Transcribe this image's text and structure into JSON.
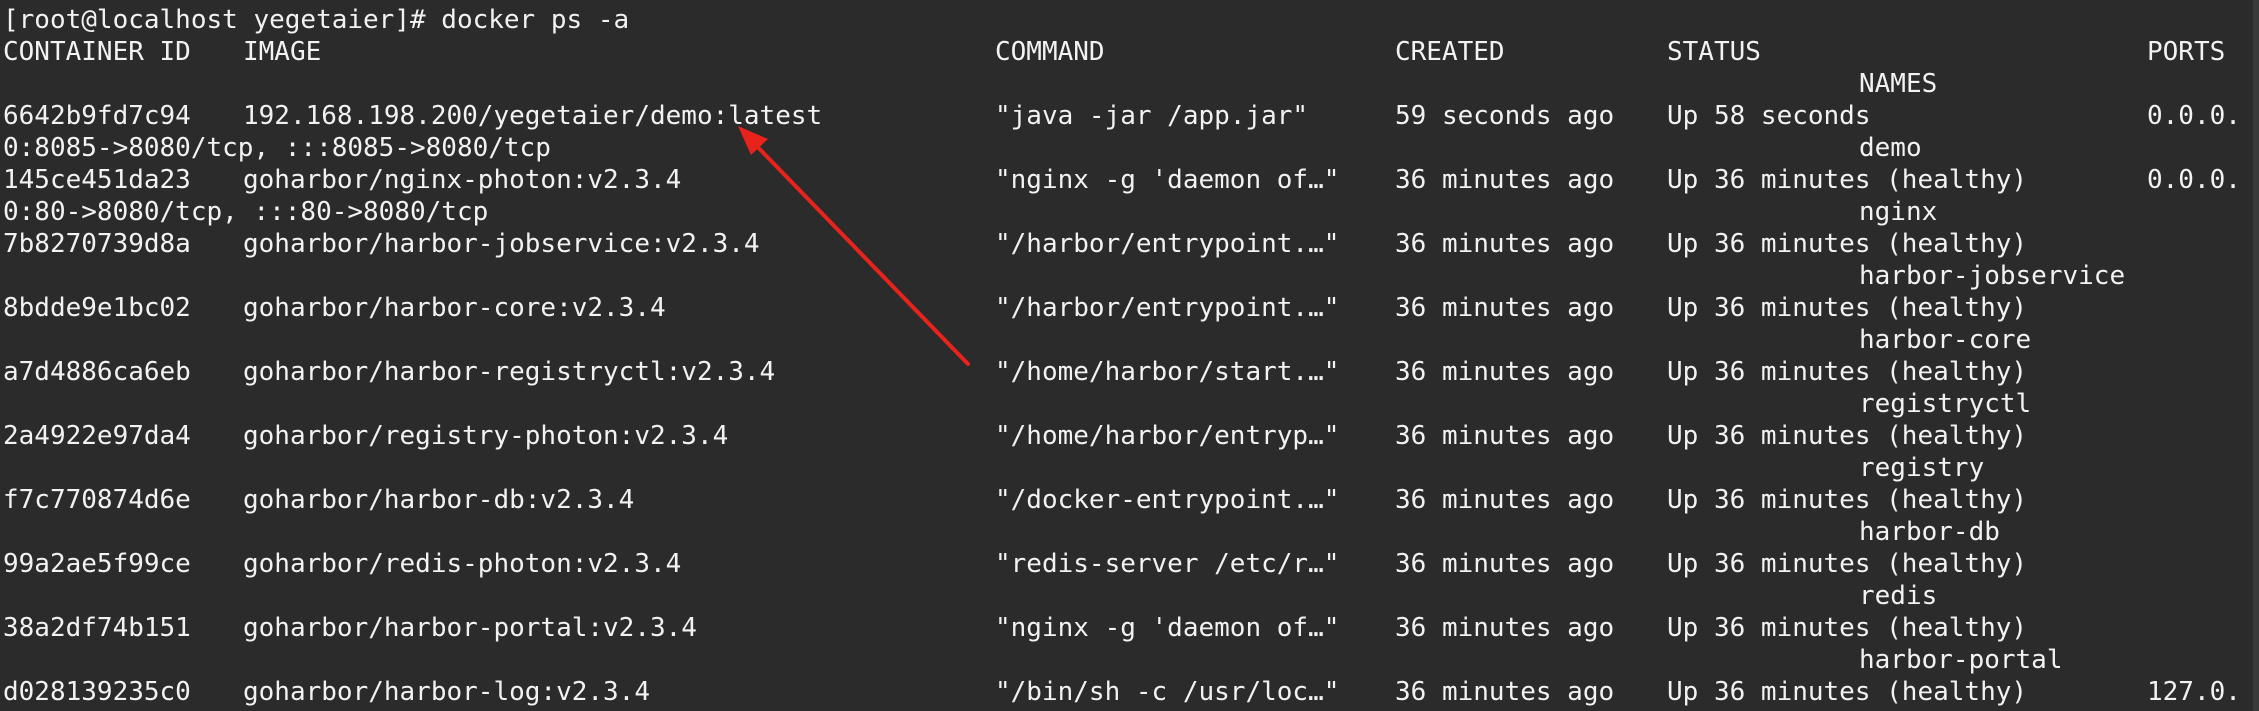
{
  "terminal": {
    "prompt_line": "[root@localhost yegetaier]# docker ps -a",
    "headers": {
      "container_id": "CONTAINER ID",
      "image": "IMAGE",
      "command": "COMMAND",
      "created": "CREATED",
      "status": "STATUS",
      "ports": "PORTS",
      "names": "NAMES"
    },
    "rows": [
      {
        "id": "6642b9fd7c94",
        "image": "192.168.198.200/yegetaier/demo:latest",
        "command": "\"java -jar /app.jar\"",
        "created": "59 seconds ago",
        "status": "Up 58 seconds",
        "ports_a": "0.0.0.",
        "ports_b": "0:8085->8080/tcp, :::8085->8080/tcp",
        "name": "demo"
      },
      {
        "id": "145ce451da23",
        "image": "goharbor/nginx-photon:v2.3.4",
        "command": "\"nginx -g 'daemon of…\"",
        "created": "36 minutes ago",
        "status": "Up 36 minutes (healthy)",
        "ports_a": "0.0.0.",
        "ports_b": "0:80->8080/tcp, :::80->8080/tcp",
        "name": "nginx"
      },
      {
        "id": "7b8270739d8a",
        "image": "goharbor/harbor-jobservice:v2.3.4",
        "command": "\"/harbor/entrypoint.…\"",
        "created": "36 minutes ago",
        "status": "Up 36 minutes (healthy)",
        "ports_a": "",
        "ports_b": "",
        "name": "harbor-jobservice"
      },
      {
        "id": "8bdde9e1bc02",
        "image": "goharbor/harbor-core:v2.3.4",
        "command": "\"/harbor/entrypoint.…\"",
        "created": "36 minutes ago",
        "status": "Up 36 minutes (healthy)",
        "ports_a": "",
        "ports_b": "",
        "name": "harbor-core"
      },
      {
        "id": "a7d4886ca6eb",
        "image": "goharbor/harbor-registryctl:v2.3.4",
        "command": "\"/home/harbor/start.…\"",
        "created": "36 minutes ago",
        "status": "Up 36 minutes (healthy)",
        "ports_a": "",
        "ports_b": "",
        "name": "registryctl"
      },
      {
        "id": "2a4922e97da4",
        "image": "goharbor/registry-photon:v2.3.4",
        "command": "\"/home/harbor/entryp…\"",
        "created": "36 minutes ago",
        "status": "Up 36 minutes (healthy)",
        "ports_a": "",
        "ports_b": "",
        "name": "registry"
      },
      {
        "id": "f7c770874d6e",
        "image": "goharbor/harbor-db:v2.3.4",
        "command": "\"/docker-entrypoint.…\"",
        "created": "36 minutes ago",
        "status": "Up 36 minutes (healthy)",
        "ports_a": "",
        "ports_b": "",
        "name": "harbor-db"
      },
      {
        "id": "99a2ae5f99ce",
        "image": "goharbor/redis-photon:v2.3.4",
        "command": "\"redis-server /etc/r…\"",
        "created": "36 minutes ago",
        "status": "Up 36 minutes (healthy)",
        "ports_a": "",
        "ports_b": "",
        "name": "redis"
      },
      {
        "id": "38a2df74b151",
        "image": "goharbor/harbor-portal:v2.3.4",
        "command": "\"nginx -g 'daemon of…\"",
        "created": "36 minutes ago",
        "status": "Up 36 minutes (healthy)",
        "ports_a": "",
        "ports_b": "",
        "name": "harbor-portal"
      },
      {
        "id": "d028139235c0",
        "image": "goharbor/harbor-log:v2.3.4",
        "command": "\"/bin/sh -c /usr/loc…\"",
        "created": "36 minutes ago",
        "status": "Up 36 minutes (healthy)",
        "ports_a": "127.0.",
        "ports_b": "",
        "name": ""
      }
    ]
  },
  "annotation": {
    "arrow_color": "#e8231c",
    "icon": "arrow-annotation-icon"
  },
  "colors": {
    "background": "#2b2b2b",
    "text": "#f2f2f2"
  }
}
